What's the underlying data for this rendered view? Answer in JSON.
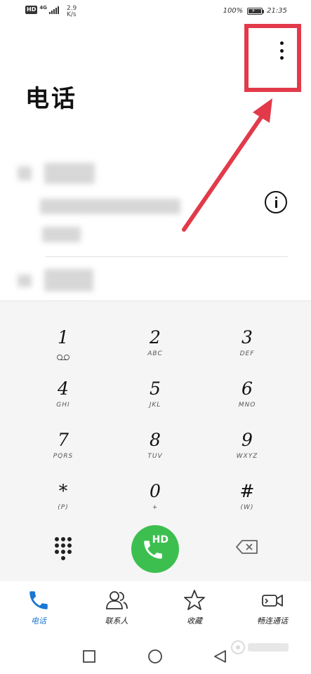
{
  "status_bar": {
    "hd": "HD",
    "network": "4G",
    "speed_value": "2.9",
    "speed_unit": "K/s",
    "battery": "100%",
    "battery_level": 1.0,
    "time": "21:35"
  },
  "header": {
    "title": "电话",
    "more_icon": "more-vertical-icon"
  },
  "call_log": {
    "info_icon": "info-icon"
  },
  "dialpad": {
    "keys": [
      {
        "digit": "1",
        "letters": ""
      },
      {
        "digit": "2",
        "letters": "ABC"
      },
      {
        "digit": "3",
        "letters": "DEF"
      },
      {
        "digit": "4",
        "letters": "GHI"
      },
      {
        "digit": "5",
        "letters": "JKL"
      },
      {
        "digit": "6",
        "letters": "MNO"
      },
      {
        "digit": "7",
        "letters": "PQRS"
      },
      {
        "digit": "8",
        "letters": "TUV"
      },
      {
        "digit": "9",
        "letters": "WXYZ"
      },
      {
        "digit": "*",
        "letters": "(P)"
      },
      {
        "digit": "0",
        "letters": "+"
      },
      {
        "digit": "#",
        "letters": "(W)"
      }
    ],
    "call_label": "HD",
    "call_color": "#3dbf4f"
  },
  "tabs": [
    {
      "label": "电话",
      "icon": "phone-icon",
      "active": true
    },
    {
      "label": "联系人",
      "icon": "contacts-icon",
      "active": false
    },
    {
      "label": "收藏",
      "icon": "star-icon",
      "active": false
    },
    {
      "label": "畅连通话",
      "icon": "video-call-icon",
      "active": false
    }
  ],
  "colors": {
    "accent": "#1c76d2",
    "highlight": "#e23a4a"
  }
}
